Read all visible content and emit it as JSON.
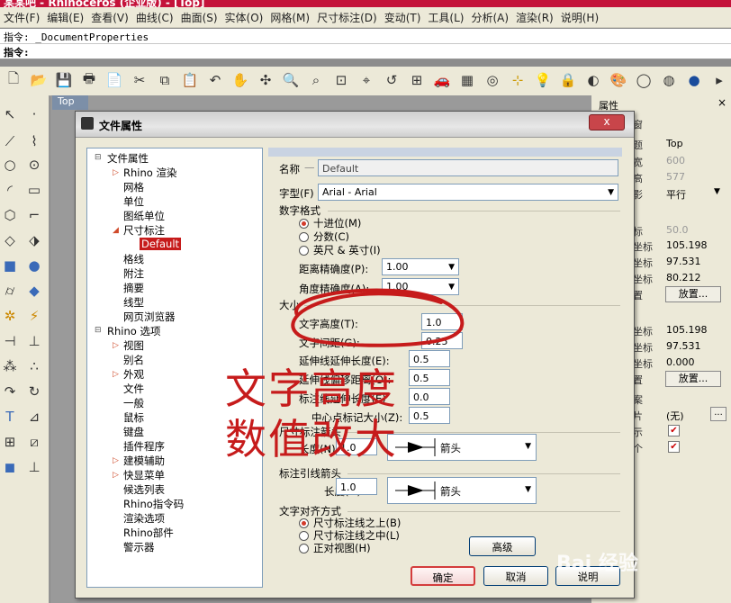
{
  "app": {
    "title": "某某吧 - Rhinoceros (企业版) - [Top]"
  },
  "menu": [
    "文件(F)",
    "编辑(E)",
    "查看(V)",
    "曲线(C)",
    "曲面(S)",
    "实体(O)",
    "网格(M)",
    "尺寸标注(D)",
    "变动(T)",
    "工具(L)",
    "分析(A)",
    "渲染(R)",
    "说明(H)"
  ],
  "command": {
    "history": "指令: _DocumentProperties",
    "prompt": "指令:"
  },
  "viewport": {
    "tab": "Top"
  },
  "properties_panel": {
    "header": "属性",
    "close": "×",
    "partial_labels": [
      "窗",
      "题",
      "宽",
      "高",
      "影",
      "影",
      "标",
      "坐标",
      "坐标",
      "坐标",
      "置",
      "坐标",
      "坐标",
      "坐标",
      "置",
      "案",
      "片",
      "示",
      "个"
    ],
    "title_value": "Top",
    "width_value": "600",
    "height_value": "577",
    "projection_value": "平行",
    "lens_value": "50.0",
    "cam_x": "105.198",
    "cam_y": "97.531",
    "cam_z": "80.212",
    "place_button": "放置...",
    "target_x": "105.198",
    "target_y": "97.531",
    "target_z": "0.000",
    "place_button2": "放置...",
    "wallpaper_value": "(无)",
    "ellipsis": "..."
  },
  "dialog": {
    "title": "文件属性",
    "close": "x",
    "tree": [
      {
        "label": "文件属性",
        "indent": 0,
        "expand": "minus"
      },
      {
        "label": "Rhino 渲染",
        "indent": 1,
        "expand": "tri"
      },
      {
        "label": "网格",
        "indent": 1
      },
      {
        "label": "单位",
        "indent": 1
      },
      {
        "label": "图纸单位",
        "indent": 1
      },
      {
        "label": "尺寸标注",
        "indent": 1,
        "expand": "tri-down"
      },
      {
        "label": "Default",
        "indent": 2,
        "selected": true
      },
      {
        "label": "格线",
        "indent": 1
      },
      {
        "label": "附注",
        "indent": 1
      },
      {
        "label": "摘要",
        "indent": 1
      },
      {
        "label": "线型",
        "indent": 1
      },
      {
        "label": "网页浏览器",
        "indent": 1
      },
      {
        "label": "Rhino 选项",
        "indent": 0,
        "expand": "minus"
      },
      {
        "label": "视图",
        "indent": 1,
        "expand": "tri"
      },
      {
        "label": "别名",
        "indent": 1
      },
      {
        "label": "外观",
        "indent": 1,
        "expand": "tri"
      },
      {
        "label": "文件",
        "indent": 1
      },
      {
        "label": "一般",
        "indent": 1
      },
      {
        "label": "鼠标",
        "indent": 1
      },
      {
        "label": "键盘",
        "indent": 1
      },
      {
        "label": "插件程序",
        "indent": 1
      },
      {
        "label": "建模辅助",
        "indent": 1,
        "expand": "tri"
      },
      {
        "label": "快显菜单",
        "indent": 1,
        "expand": "tri"
      },
      {
        "label": "候选列表",
        "indent": 1
      },
      {
        "label": "Rhino指令码",
        "indent": 1
      },
      {
        "label": "渲染选项",
        "indent": 1
      },
      {
        "label": "Rhino部件",
        "indent": 1
      },
      {
        "label": "警示器",
        "indent": 1
      }
    ],
    "name_label": "名称",
    "name_value": "Default",
    "font_label": "字型(F)",
    "font_value": "Arial - Arial",
    "number_format": {
      "section": "数字格式",
      "options": [
        "十进位(M)",
        "分数(C)",
        "英尺 & 英寸(I)"
      ],
      "selected": 0,
      "dist_precision_label": "距离精确度(P):",
      "dist_precision_value": "1.00",
      "angle_precision_label": "角度精确度(A):",
      "angle_precision_value": "1.00"
    },
    "size_section": "大小",
    "size_fields": [
      {
        "label": "文字高度(T):",
        "value": "1.0"
      },
      {
        "label": "文字间距(G):",
        "value": "0.25"
      },
      {
        "label": "延伸线延伸长度(E):",
        "value": "0.5"
      },
      {
        "label": "延伸线偏移距离(O):",
        "value": "0.5"
      },
      {
        "label": "标注线延伸长度(E)",
        "value": "0.0"
      },
      {
        "label": "中心点标记大小(Z):",
        "value": "0.5"
      }
    ],
    "dim_arrow": {
      "section": "尺寸标注箭头",
      "length_label": "长度(N):",
      "length_value": "1.0",
      "style": "箭头"
    },
    "leader_arrow": {
      "section": "标注引线箭头",
      "length_label": "长度(G):",
      "length_value": "1.0",
      "style": "箭头"
    },
    "text_align": {
      "section": "文字对齐方式",
      "options": [
        "尺寸标注线之上(B)",
        "尺寸标注线之中(L)",
        "正对视图(H)"
      ],
      "selected": 0
    },
    "advanced_button": "高级",
    "ok_button": "确定",
    "cancel_button": "取消",
    "help_button": "说明"
  },
  "annotation": {
    "line1": "文字高度",
    "line2": "数值改大",
    "color": "#c61b1b"
  },
  "watermark": "Bai 经验"
}
